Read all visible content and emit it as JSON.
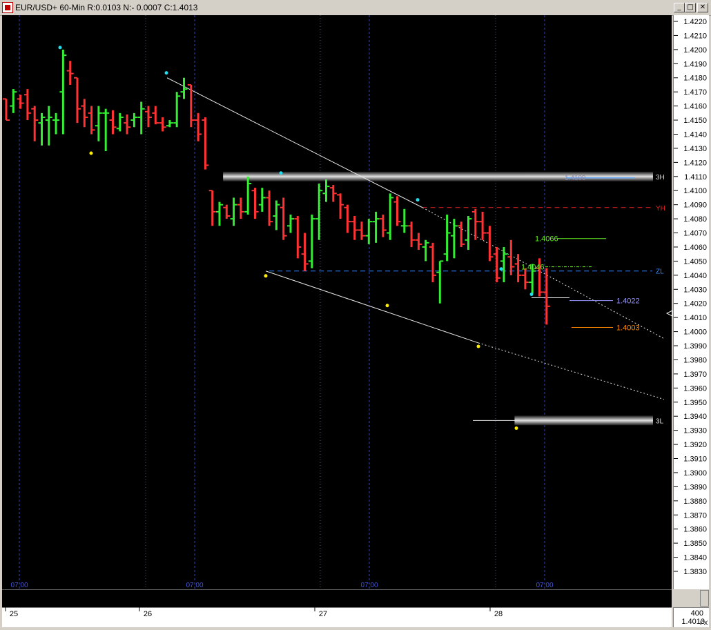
{
  "window": {
    "title": "EUR/USD+ 60-Min R:0.0103 N:- 0.0007 C:1.4013",
    "buttons": {
      "minimize": "_",
      "maximize": "□",
      "close": "✕"
    }
  },
  "readout": {
    "count": "400",
    "price": "1.4013"
  },
  "fx_label": "FX",
  "colors": {
    "background": "#000000",
    "up_bar": "#33ee33",
    "down_bar": "#ff3333",
    "grid_vertical": "#3344bb",
    "trendline": "#e8e8e8",
    "swing_high": "#22ddee",
    "swing_low": "#ffee00",
    "zl_line": "#3388ff",
    "yh_line": "#ee2222",
    "level_green": "#66ee22",
    "level_blue": "#9999ff",
    "level_orange": "#ff8800",
    "band": "#c8c8c8"
  },
  "chart_data": {
    "type": "ohlc",
    "symbol": "EUR/USD+",
    "interval": "60-Min",
    "ylim": [
      1.3822,
      1.4226
    ],
    "y_ticks": [
      "1.4220",
      "1.4210",
      "1.4200",
      "1.4190",
      "1.4180",
      "1.4170",
      "1.4160",
      "1.4150",
      "1.4140",
      "1.4130",
      "1.4120",
      "1.4110",
      "1.4100",
      "1.4090",
      "1.4080",
      "1.4070",
      "1.4060",
      "1.4050",
      "1.4040",
      "1.4030",
      "1.4020",
      "1.4010",
      "1.4000",
      "1.3990",
      "1.3980",
      "1.3970",
      "1.3960",
      "1.3950",
      "1.3940",
      "1.3930",
      "1.3920",
      "1.3910",
      "1.3900",
      "1.3890",
      "1.3880",
      "1.3870",
      "1.3860",
      "1.3850",
      "1.3840",
      "1.3830"
    ],
    "x_range": [
      0,
      76
    ],
    "date_labels": [
      {
        "label": "25",
        "x": 0
      },
      {
        "label": "26",
        "x": 15.8
      },
      {
        "label": "27",
        "x": 35.7
      },
      {
        "label": "28",
        "x": 55.8
      }
    ],
    "time_labels": [
      {
        "label": "07:00",
        "x": 1.5
      },
      {
        "label": "07:00",
        "x": 21.5
      },
      {
        "label": "07:00",
        "x": 41.5
      },
      {
        "label": "07:00",
        "x": 61.5
      }
    ],
    "dotted_separators": [
      16.3,
      36.3,
      56.4
    ],
    "bars": [
      [
        0,
        1.4165,
        1.4165,
        1.415,
        1.415
      ],
      [
        1,
        1.416,
        1.4172,
        1.4155,
        1.417
      ],
      [
        2,
        1.4165,
        1.4168,
        1.4158,
        1.4162
      ],
      [
        3,
        1.4168,
        1.4172,
        1.415,
        1.4155
      ],
      [
        4,
        1.4158,
        1.416,
        1.4135,
        1.415
      ],
      [
        5,
        1.4148,
        1.4155,
        1.4132,
        1.4152
      ],
      [
        6,
        1.415,
        1.416,
        1.4132,
        1.4152
      ],
      [
        7,
        1.415,
        1.4155,
        1.414,
        1.415
      ],
      [
        8,
        1.417,
        1.42,
        1.414,
        1.4196
      ],
      [
        9,
        1.4185,
        1.4192,
        1.4175,
        1.4183
      ],
      [
        10,
        1.418,
        1.418,
        1.4148,
        1.4158
      ],
      [
        11,
        1.416,
        1.4165,
        1.4145,
        1.4152
      ],
      [
        12,
        1.4155,
        1.416,
        1.414,
        1.4143
      ],
      [
        13,
        1.4146,
        1.416,
        1.4135,
        1.4155
      ],
      [
        14,
        1.4155,
        1.4158,
        1.4128,
        1.4155
      ],
      [
        15,
        1.415,
        1.4157,
        1.414,
        1.4145
      ],
      [
        16,
        1.4144,
        1.4155,
        1.4142,
        1.4152
      ],
      [
        17,
        1.4148,
        1.4154,
        1.414,
        1.4145
      ],
      [
        18,
        1.415,
        1.4155,
        1.4145,
        1.4152
      ],
      [
        19,
        1.4152,
        1.4163,
        1.414,
        1.4158
      ],
      [
        20,
        1.4156,
        1.416,
        1.4145,
        1.4152
      ],
      [
        21,
        1.4155,
        1.416,
        1.4147,
        1.4148
      ],
      [
        22,
        1.4148,
        1.4152,
        1.4142,
        1.4145
      ],
      [
        23,
        1.4146,
        1.415,
        1.4145,
        1.4148
      ],
      [
        24,
        1.4148,
        1.417,
        1.4145,
        1.4167
      ],
      [
        25,
        1.417,
        1.418,
        1.4165,
        1.4172
      ],
      [
        26,
        1.4175,
        1.4175,
        1.4145,
        1.415
      ],
      [
        27,
        1.415,
        1.4155,
        1.4135,
        1.414
      ],
      [
        28,
        1.415,
        1.4152,
        1.4115,
        1.4118
      ],
      [
        29,
        1.41,
        1.41,
        1.4075,
        1.4085
      ],
      [
        30,
        1.4085,
        1.4092,
        1.4075,
        1.409
      ],
      [
        31,
        1.4088,
        1.409,
        1.408,
        1.4082
      ],
      [
        32,
        1.408,
        1.4095,
        1.4075,
        1.409
      ],
      [
        33,
        1.409,
        1.4095,
        1.408,
        1.4085
      ],
      [
        34,
        1.4085,
        1.411,
        1.4083,
        1.4105
      ],
      [
        35,
        1.41,
        1.4102,
        1.408,
        1.4085
      ],
      [
        36,
        1.409,
        1.4102,
        1.4085,
        1.4095
      ],
      [
        37,
        1.4095,
        1.41,
        1.4075,
        1.4078
      ],
      [
        38,
        1.4082,
        1.4093,
        1.4072,
        1.409
      ],
      [
        39,
        1.4088,
        1.4095,
        1.4065,
        1.4068
      ],
      [
        40,
        1.4075,
        1.4083,
        1.407,
        1.408
      ],
      [
        41,
        1.408,
        1.4082,
        1.4052,
        1.406
      ],
      [
        42,
        1.4055,
        1.407,
        1.4043,
        1.4048
      ],
      [
        43,
        1.405,
        1.4083,
        1.4045,
        1.408
      ],
      [
        44,
        1.408,
        1.4105,
        1.4065,
        1.41
      ],
      [
        45,
        1.4098,
        1.4108,
        1.4092,
        1.4103
      ],
      [
        46,
        1.4102,
        1.4104,
        1.4092,
        1.4098
      ],
      [
        47,
        1.4097,
        1.4098,
        1.408,
        1.409
      ],
      [
        48,
        1.4088,
        1.409,
        1.407,
        1.4078
      ],
      [
        49,
        1.4078,
        1.4082,
        1.4065,
        1.4072
      ],
      [
        50,
        1.4072,
        1.4078,
        1.4065,
        1.4068
      ],
      [
        51,
        1.4068,
        1.408,
        1.4062,
        1.4078
      ],
      [
        52,
        1.4078,
        1.4085,
        1.4063,
        1.408
      ],
      [
        53,
        1.408,
        1.4083,
        1.4067,
        1.4072
      ],
      [
        54,
        1.407,
        1.4098,
        1.4065,
        1.4095
      ],
      [
        55,
        1.4092,
        1.4096,
        1.4075,
        1.4078
      ],
      [
        56,
        1.4075,
        1.4087,
        1.407,
        1.4075
      ],
      [
        57,
        1.4075,
        1.4078,
        1.406,
        1.4065
      ],
      [
        58,
        1.4065,
        1.407,
        1.4058,
        1.4062
      ],
      [
        59,
        1.406,
        1.4065,
        1.405,
        1.4063
      ],
      [
        60,
        1.406,
        1.4063,
        1.4035,
        1.404
      ],
      [
        61,
        1.4042,
        1.405,
        1.402,
        1.405
      ],
      [
        62,
        1.4055,
        1.4083,
        1.405,
        1.407
      ],
      [
        63,
        1.4068,
        1.408,
        1.4052,
        1.4075
      ],
      [
        64,
        1.4075,
        1.4078,
        1.406,
        1.4062
      ],
      [
        65,
        1.4065,
        1.4082,
        1.4058,
        1.408
      ],
      [
        66,
        1.4085,
        1.4087,
        1.4065,
        1.4078
      ],
      [
        67,
        1.4078,
        1.4085,
        1.4065,
        1.407
      ],
      [
        68,
        1.407,
        1.4075,
        1.405,
        1.4053
      ],
      [
        69,
        1.4055,
        1.406,
        1.4035,
        1.4038
      ],
      [
        70,
        1.405,
        1.406,
        1.4035,
        1.4055
      ],
      [
        71,
        1.4053,
        1.4065,
        1.404,
        1.4046
      ],
      [
        72,
        1.4048,
        1.4055,
        1.4035,
        1.404
      ],
      [
        73,
        1.404,
        1.4045,
        1.403,
        1.4035
      ],
      [
        74,
        1.4035,
        1.4048,
        1.4027,
        1.4043
      ],
      [
        75,
        1.4045,
        1.4052,
        1.4025,
        1.4028
      ],
      [
        76,
        1.4028,
        1.4045,
        1.4005,
        1.4018
      ]
    ],
    "levels": [
      {
        "name": "3H",
        "value": 1.411,
        "type": "band",
        "label": "3H",
        "text": "1.4109",
        "x_start": 30.5
      },
      {
        "name": "YH",
        "value": 1.4088,
        "type": "dashed",
        "label": "YH",
        "x_start": 58.5
      },
      {
        "name": "ZL",
        "value": 1.4043,
        "type": "dashed",
        "label": "ZL",
        "x_start": 37
      },
      {
        "name": "3L",
        "value": 1.3937,
        "type": "band",
        "label": "3L",
        "x_start": 71.5
      }
    ],
    "price_tags": [
      {
        "text": "1.4066",
        "value": 1.4066
      },
      {
        "text": "1.4046",
        "value": 1.4046
      },
      {
        "text": "1.4022",
        "value": 1.4022
      },
      {
        "text": "1.4003",
        "value": 1.4003
      }
    ]
  }
}
